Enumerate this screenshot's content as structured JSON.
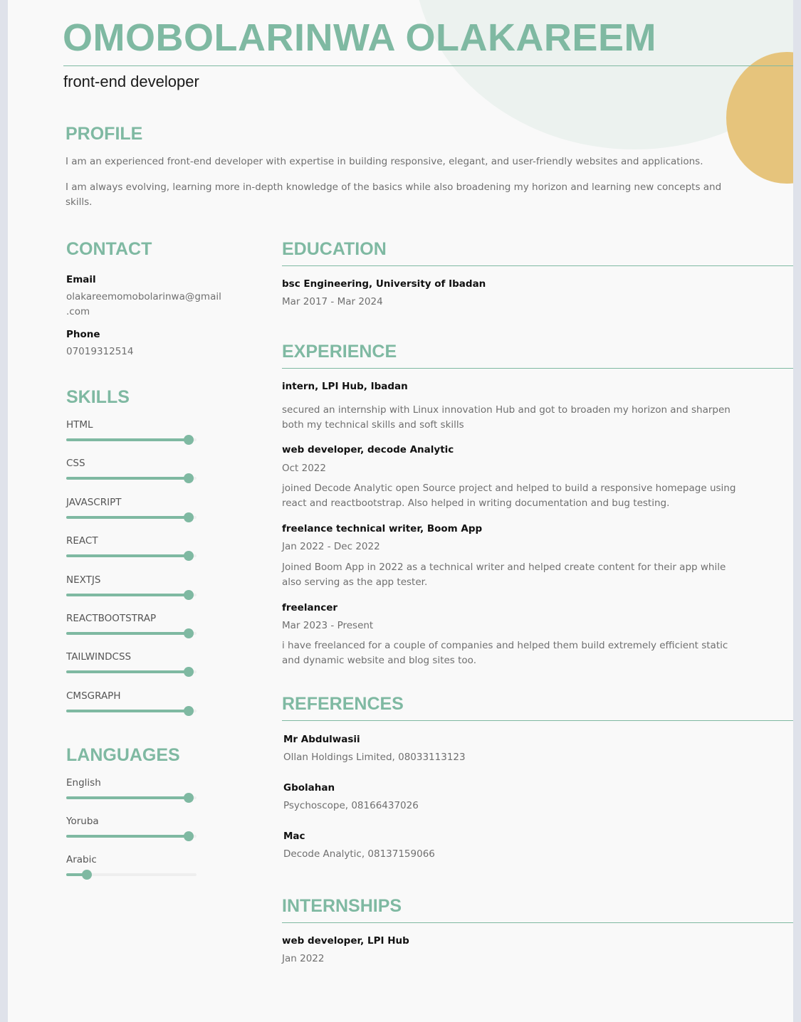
{
  "header": {
    "name": "OMOBOLARINWA OLAKAREEM",
    "role": "front-end developer"
  },
  "colors": {
    "accent": "#7fb9a2",
    "gold": "#e6c47c",
    "page": "#f9f9f9"
  },
  "profile": {
    "heading": "PROFILE",
    "p1": "I am an experienced front-end developer with expertise in building responsive, elegant, and user-friendly websites and applications.",
    "p2": "I am always evolving, learning more in-depth knowledge of the basics while also broadening my horizon and learning new concepts and skills."
  },
  "contact": {
    "heading": "CONTACT",
    "email_label": "Email",
    "email_line1": "olakareemomobolarinwa@gmail",
    "email_line2": ".com",
    "phone_label": "Phone",
    "phone": "07019312514"
  },
  "skills": {
    "heading": "SKILLS",
    "items": [
      {
        "name": "HTML",
        "level": 0.94
      },
      {
        "name": "CSS",
        "level": 0.94
      },
      {
        "name": "JAVASCRIPT",
        "level": 0.94
      },
      {
        "name": "REACT",
        "level": 0.94
      },
      {
        "name": "NEXTJS",
        "level": 0.94
      },
      {
        "name": "REACTBOOTSTRAP",
        "level": 0.94
      },
      {
        "name": "TAILWINDCSS",
        "level": 0.94
      },
      {
        "name": "CMSGRAPH",
        "level": 0.94
      }
    ]
  },
  "languages": {
    "heading": "LANGUAGES",
    "items": [
      {
        "name": "English",
        "level": 0.94
      },
      {
        "name": "Yoruba",
        "level": 0.94
      },
      {
        "name": "Arabic",
        "level": 0.16
      }
    ]
  },
  "education": {
    "heading": "EDUCATION",
    "title": "bsc Engineering, University of Ibadan",
    "date": "Mar 2017 - Mar 2024"
  },
  "experience": {
    "heading": "EXPERIENCE",
    "items": [
      {
        "title": "intern, LPI Hub, Ibadan",
        "date": "",
        "line1": "secured an internship with Linux innovation Hub and got to broaden my horizon and sharpen",
        "line2": "both my technical skills and soft skills"
      },
      {
        "title": "web developer, decode Analytic",
        "date": "Oct 2022",
        "line1": "joined Decode Analytic open Source project and helped to build a responsive homepage using",
        "line2": "react and reactbootstrap. Also helped in writing documentation and bug testing."
      },
      {
        "title": "freelance technical writer, Boom App",
        "date": "Jan 2022 - Dec 2022",
        "line1": "Joined Boom App in 2022 as a technical writer and helped create content for their app while",
        "line2": "also serving as the app tester."
      },
      {
        "title": "freelancer",
        "date": "Mar 2023 - Present",
        "line1": "i have freelanced for a couple of companies and helped them build extremely efficient static",
        "line2": "and dynamic website and blog sites too."
      }
    ]
  },
  "references": {
    "heading": "REFERENCES",
    "items": [
      {
        "name": "Mr Abdulwasii",
        "detail": "Ollan Holdings Limited, 08033113123"
      },
      {
        "name": "Gbolahan",
        "detail": "Psychoscope, 08166437026"
      },
      {
        "name": "Mac",
        "detail": "Decode Analytic, 08137159066"
      }
    ]
  },
  "internships": {
    "heading": "INTERNSHIPS",
    "title": "web developer, LPI Hub",
    "date": "Jan 2022"
  }
}
